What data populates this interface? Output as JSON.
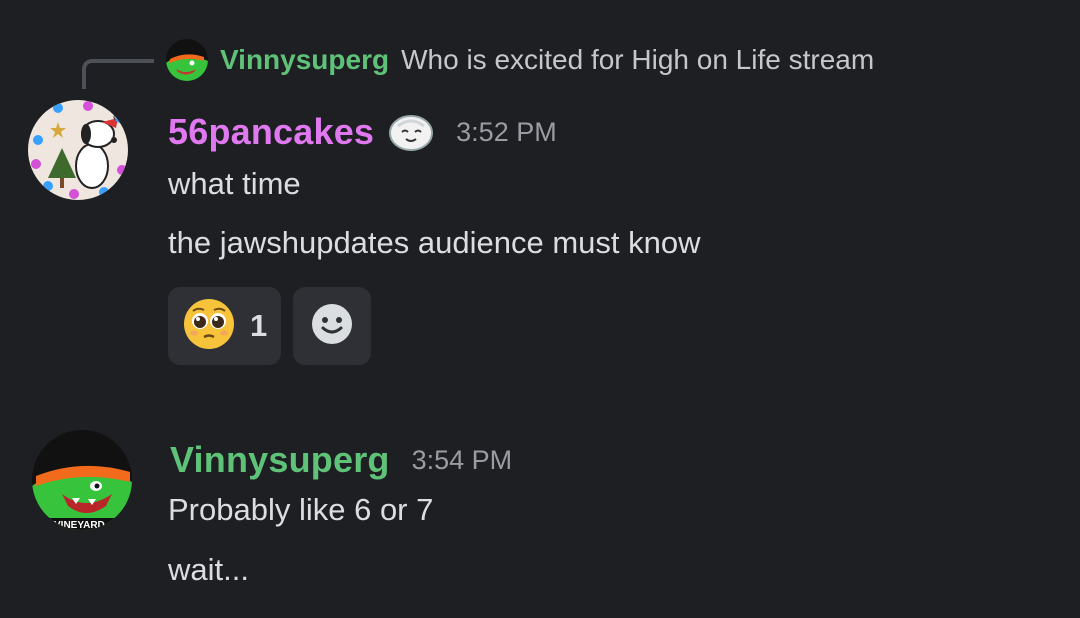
{
  "reply": {
    "author": "Vinnysuperg",
    "text": "Who is excited for High on Life stream"
  },
  "messages": [
    {
      "author": "56pancakes",
      "badge_icon": "snowball-face-icon",
      "timestamp": "3:52 PM",
      "lines": [
        "what time",
        "the jawshupdates audience must know"
      ],
      "reactions": [
        {
          "emoji": "pleading-face-icon",
          "count": "1"
        }
      ],
      "add_reaction_icon": "add-reaction-smiley-icon"
    },
    {
      "author": "Vinnysuperg",
      "timestamp": "3:54 PM",
      "lines": [
        "Probably like 6 or 7",
        "wait..."
      ],
      "avatar_text": "VINEYARD"
    }
  ],
  "colors": {
    "background": "#1e1f22",
    "author_pink": "#e079f0",
    "author_green": "#5fc279",
    "reaction_bg": "#2e3036",
    "timestamp": "#9a9ca3"
  }
}
